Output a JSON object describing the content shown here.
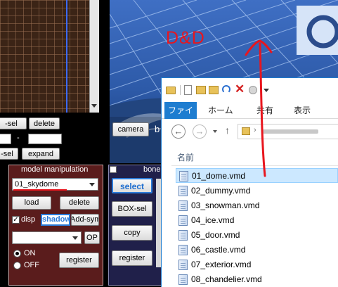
{
  "timeline": {
    "frame_sel_label": "-sel",
    "delete_label": "delete",
    "dash": "-",
    "sel_label": "-sel",
    "expand_label": "expand"
  },
  "model_panel": {
    "title": "model manipulation",
    "selected_model": "01_skydome",
    "load_label": "load",
    "delete_label": "delete",
    "disp_label": "disp",
    "shadow_label": "shadow",
    "add_sym_label": "Add-sym",
    "op_label": "OP",
    "on_label": "ON",
    "off_label": "OFF",
    "register_label": "register"
  },
  "bone_panel": {
    "title": "bone",
    "select_label": "select",
    "box_sel_label": "BOX-sel",
    "copy_label": "copy",
    "register_label": "register"
  },
  "viewport": {
    "dd_text": "D&D",
    "camera_label": "camera",
    "trailing_char": "b"
  },
  "explorer": {
    "ribbon_tabs": [
      "ファイル",
      "ホーム",
      "共有",
      "表示"
    ],
    "column_header": "名前",
    "files": [
      "01_dome.vmd",
      "02_dummy.vmd",
      "03_snowman.vmd",
      "04_ice.vmd",
      "05_door.vmd",
      "06_castle.vmd",
      "07_exterior.vmd",
      "08_chandelier.vmd"
    ]
  },
  "colors": {
    "annotation_red": "#e8161e",
    "panel_maroon": "#5a1c1c",
    "explorer_blue": "#1e7dd0"
  }
}
